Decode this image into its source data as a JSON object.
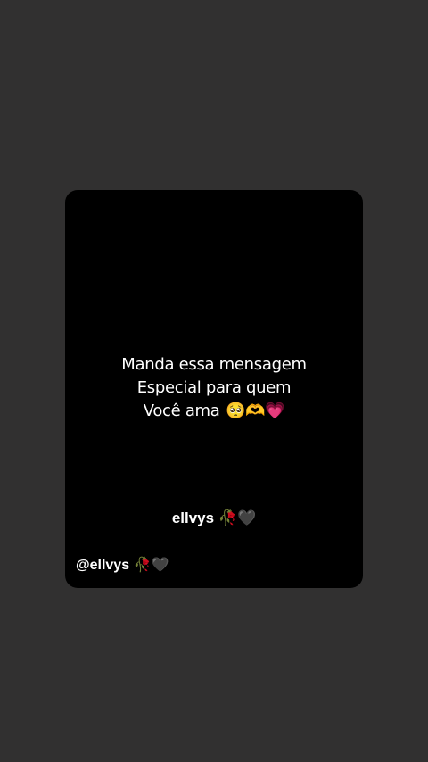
{
  "message": {
    "line1": "Manda essa mensagem",
    "line2": "Especial para quem",
    "line3": "Você ama",
    "line3_emojis": "🥺🫶💗"
  },
  "signature": {
    "name": "ellvys",
    "emojis": "🥀🖤"
  },
  "handle": {
    "text": "@ellvys",
    "emojis": "🥀🖤"
  },
  "colors": {
    "background": "#313030",
    "card": "#000000",
    "text": "#ffffff"
  }
}
